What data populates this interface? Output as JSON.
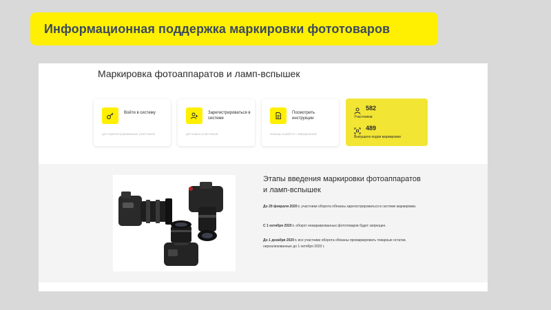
{
  "banner": {
    "title": "Информационная поддержка маркировки фототоваров"
  },
  "page": {
    "title": "Маркировка фотоаппаратов и ламп-вспышек",
    "cards": [
      {
        "label": "Войти в систему",
        "sub": "для зарегистрированных участников",
        "icon": "key-icon"
      },
      {
        "label": "Зарегистрироваться в системе",
        "sub": "для новых участников",
        "icon": "user-add-icon"
      },
      {
        "label": "Посмотреть инструкции",
        "sub": "помощь в работе с маркировкой",
        "icon": "document-icon"
      }
    ],
    "stats": {
      "participants_value": "582",
      "participants_label": "Участников",
      "codes_value": "489",
      "codes_label": "Выпущено кодов маркировки"
    },
    "stages": {
      "title": "Этапы введения маркировки фотоаппаратов и ламп-вспышек",
      "items": [
        {
          "date": "До 29 февраля 2020 г.",
          "text": " участники оборота обязаны зарегистрироваться в системе маркировки."
        },
        {
          "date": "С 1 октября 2020 г.",
          "text": " оборот немаркированных фототоваров будет запрещен."
        },
        {
          "date": "До 1 декабря 2020 г.",
          "text": " все участники оборота обязаны промаркировать товарные остатки, нереализованные до 1 октября 2020 г."
        }
      ]
    }
  },
  "colors": {
    "accent": "#ffef00",
    "stats_bg": "#f2e534",
    "title_text": "#3a4a5e"
  }
}
